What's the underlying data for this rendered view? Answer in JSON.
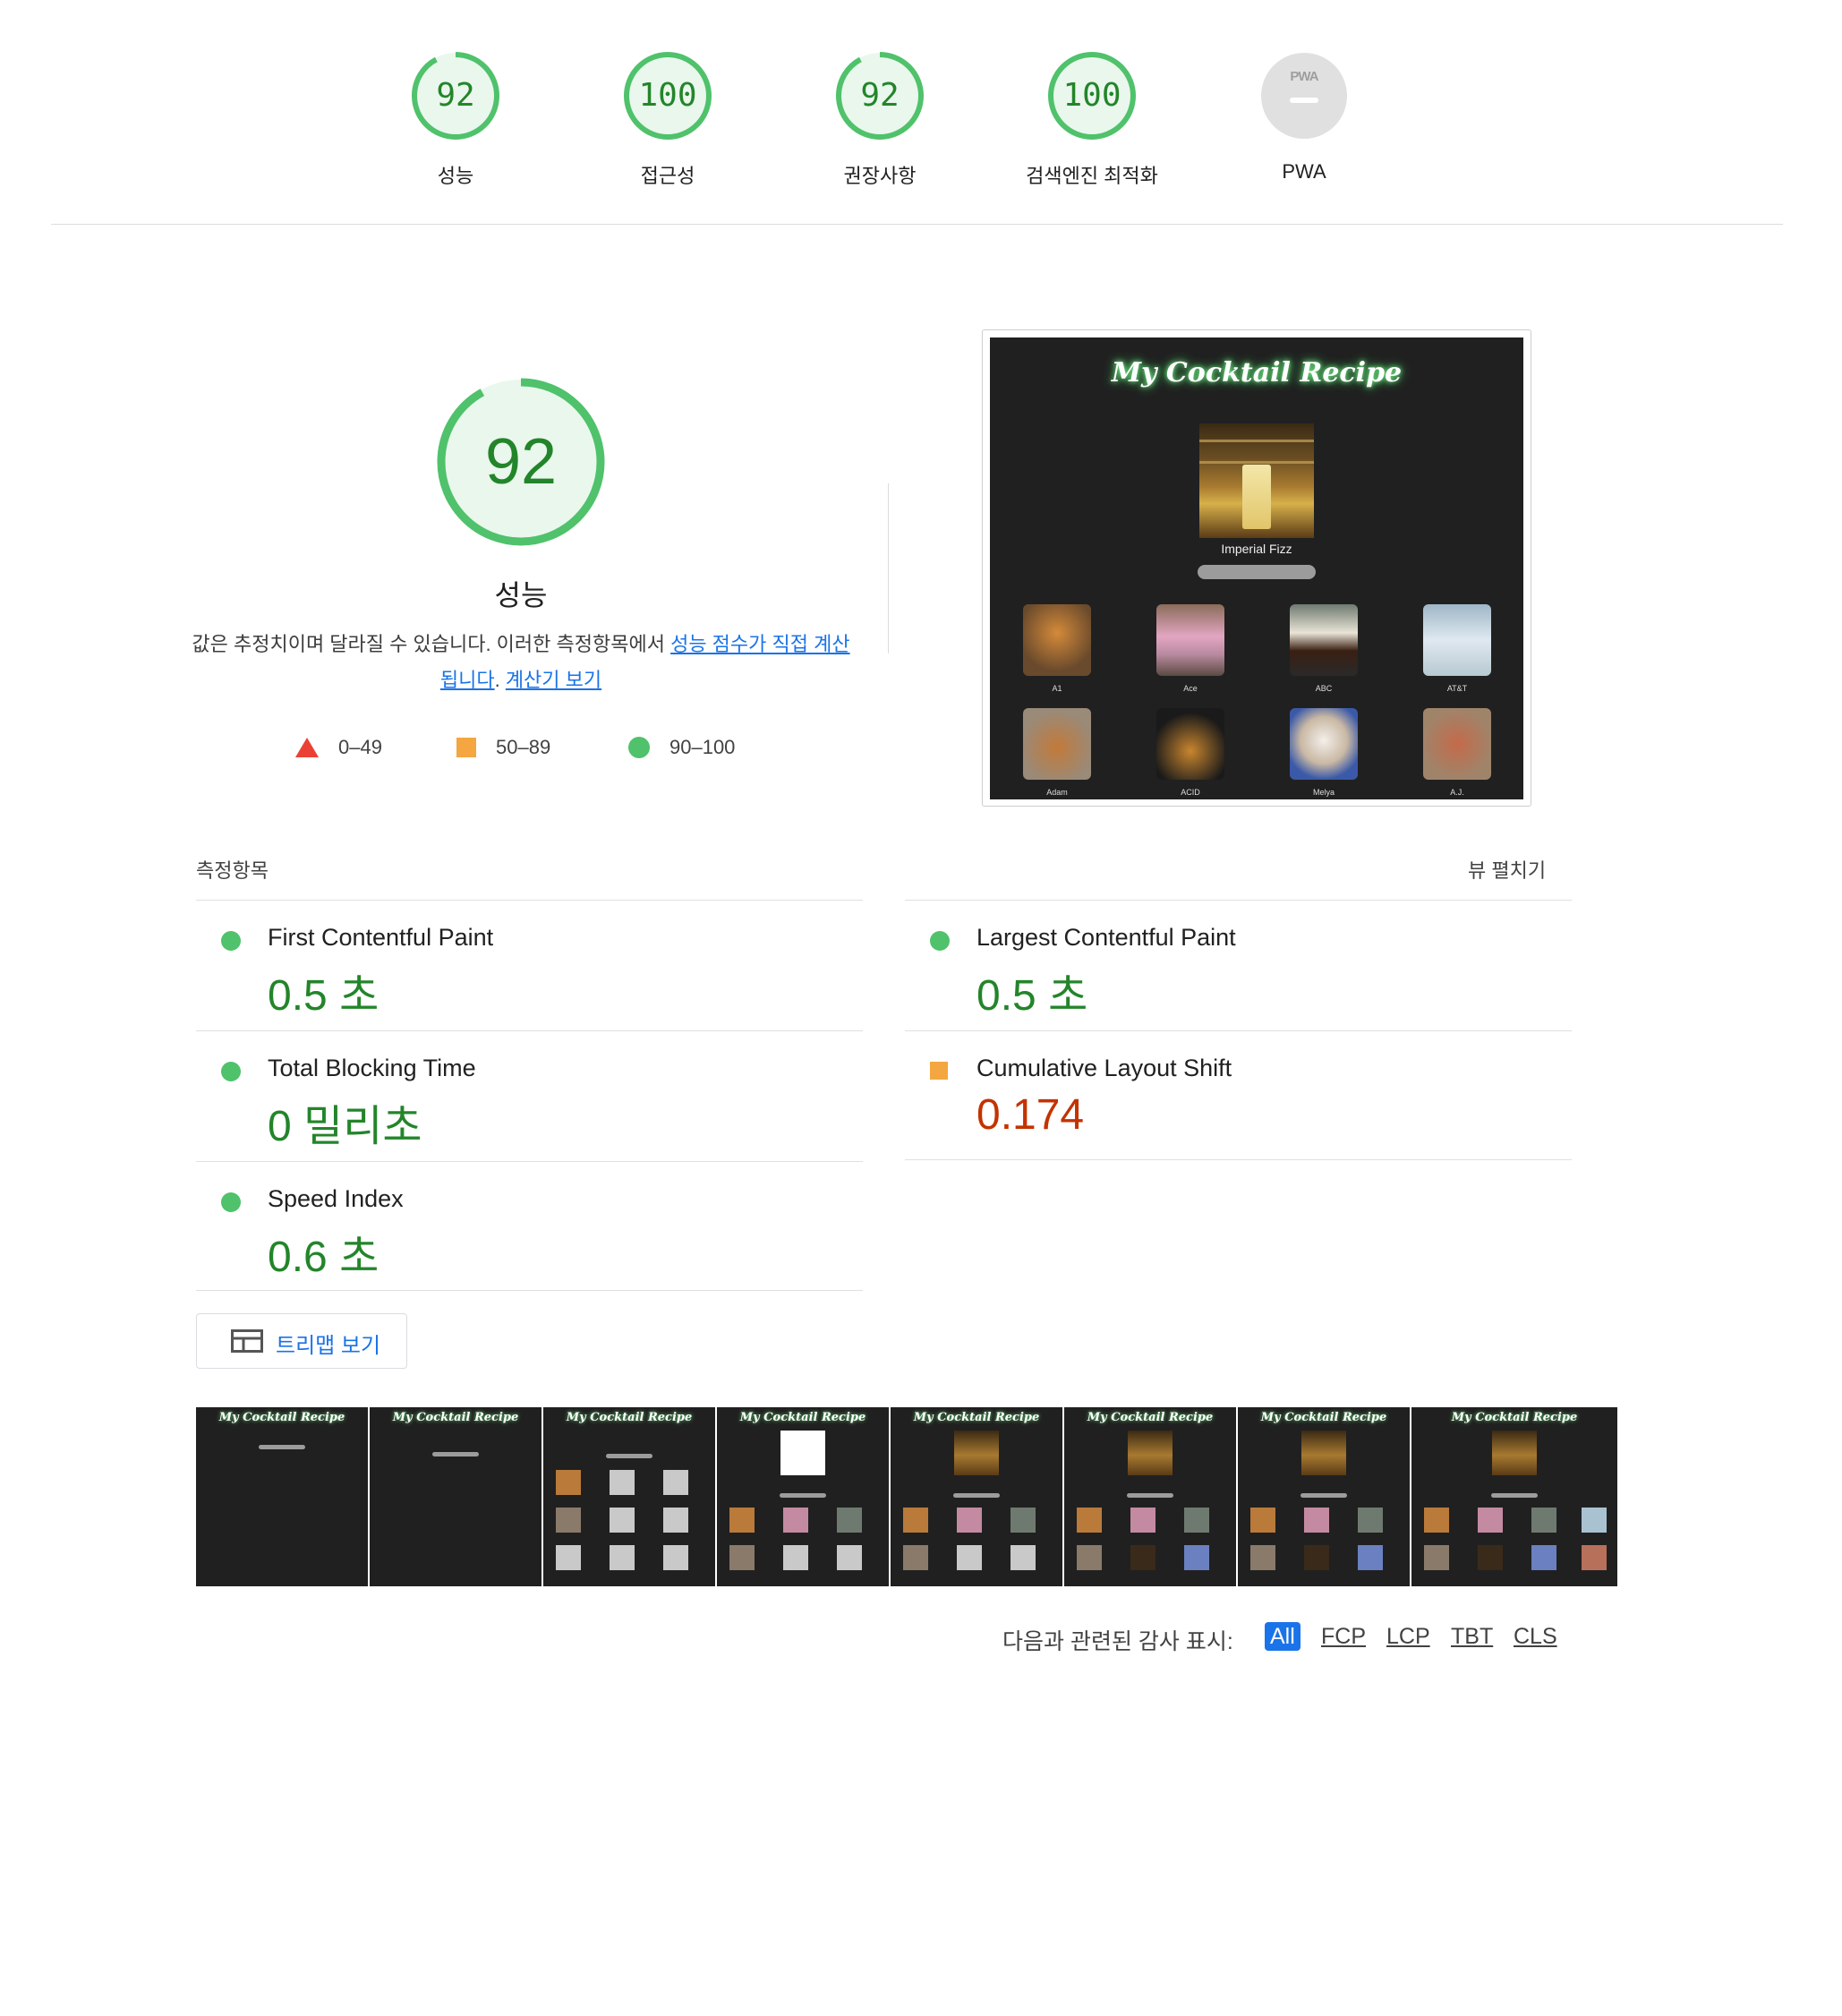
{
  "gauges": [
    {
      "score": "92",
      "label": "성능"
    },
    {
      "score": "100",
      "label": "접근성"
    },
    {
      "score": "92",
      "label": "권장사항"
    },
    {
      "score": "100",
      "label": "검색엔진 최적화"
    }
  ],
  "pwa": {
    "badge_text": "PWA",
    "label": "PWA"
  },
  "colors": {
    "pass": "#23852a",
    "pass_ring": "#4fc26b",
    "average": "#f4a640",
    "fail": "#eb4034",
    "link": "#1a73e8"
  },
  "performance": {
    "score": "92",
    "title": "성능",
    "desc_pre": "값은 추정치이며 달라질 수 있습니다. 이러한 측정항목에서 ",
    "desc_link1": "성능 점수가 직접 계산됩니다",
    "desc_mid": ". ",
    "desc_link2": "계산기 보기"
  },
  "legend": [
    {
      "icon": "triangle-icon",
      "range": "0–49"
    },
    {
      "icon": "square-icon",
      "range": "50–89"
    },
    {
      "icon": "circle-icon",
      "range": "90–100"
    }
  ],
  "final_screenshot": {
    "site_title": "My Cocktail Recipe",
    "hero_caption": "Imperial Fizz",
    "thumbs": [
      "A1",
      "Ace",
      "ABC",
      "AT&T",
      "Adam",
      "ACID",
      "Melya",
      "A.J."
    ]
  },
  "metrics": {
    "header": "측정항목",
    "expand_label": "뷰 펼치기",
    "items": [
      {
        "name": "First Contentful Paint",
        "value": "0.5 초",
        "rating": "pass"
      },
      {
        "name": "Largest Contentful Paint",
        "value": "0.5 초",
        "rating": "pass"
      },
      {
        "name": "Total Blocking Time",
        "value": "0 밀리초",
        "rating": "pass"
      },
      {
        "name": "Cumulative Layout Shift",
        "value": "0.174",
        "rating": "average"
      },
      {
        "name": "Speed Index",
        "value": "0.6 초",
        "rating": "pass"
      }
    ]
  },
  "treemap_button": "트리맵 보기",
  "filmstrip": {
    "frame_title": "My Cocktail Recipe",
    "frame_count": 8
  },
  "audit_filter": {
    "label": "다음과 관련된 감사 표시:",
    "chips": [
      "All",
      "FCP",
      "LCP",
      "TBT",
      "CLS"
    ],
    "active": "All"
  }
}
